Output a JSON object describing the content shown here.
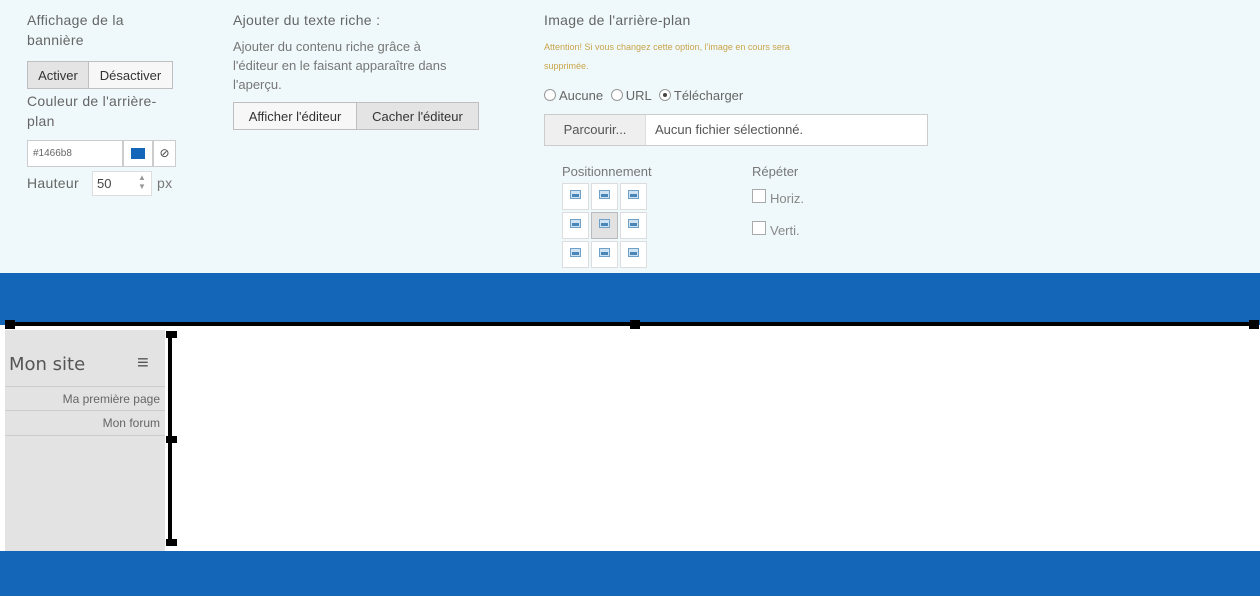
{
  "banner_settings": {
    "display": {
      "title_line1": "Affichage de la",
      "title_line2": "bannière",
      "activate_label": "Activer",
      "deactivate_label": "Désactiver"
    },
    "bg_color": {
      "title_line1": "Couleur de l'arrière-",
      "title_line2": "plan",
      "value": "#1466b8",
      "swatch": "#1466b8"
    },
    "height": {
      "label": "Hauteur",
      "value": "50",
      "unit": "px"
    }
  },
  "rich_text": {
    "title": "Ajouter du texte riche :",
    "desc_line1": "Ajouter du contenu riche grâce à",
    "desc_line2": "l'éditeur en le faisant apparaître dans",
    "desc_line3": "l'aperçu.",
    "show_label": "Afficher l'éditeur",
    "hide_label": "Cacher l'éditeur"
  },
  "bg_image": {
    "title": "Image de l'arrière-plan",
    "warning_line1": "Attention! Si vous changez cette option, l'image en cours sera",
    "warning_line2": "supprimée.",
    "options": [
      "Aucune",
      "URL",
      "Télécharger"
    ],
    "selected": "Télécharger",
    "browse_label": "Parcourir...",
    "file_status": "Aucun fichier sélectionné.",
    "positioning_label": "Positionnement",
    "repeat_label": "Répéter",
    "repeat_h": "Horiz.",
    "repeat_v": "Verti."
  },
  "preview": {
    "site_title": "Mon site",
    "menu_icon": "hamburger-icon",
    "nav": [
      "Ma première page",
      "Mon forum"
    ],
    "brand_color": "#1466b8"
  }
}
